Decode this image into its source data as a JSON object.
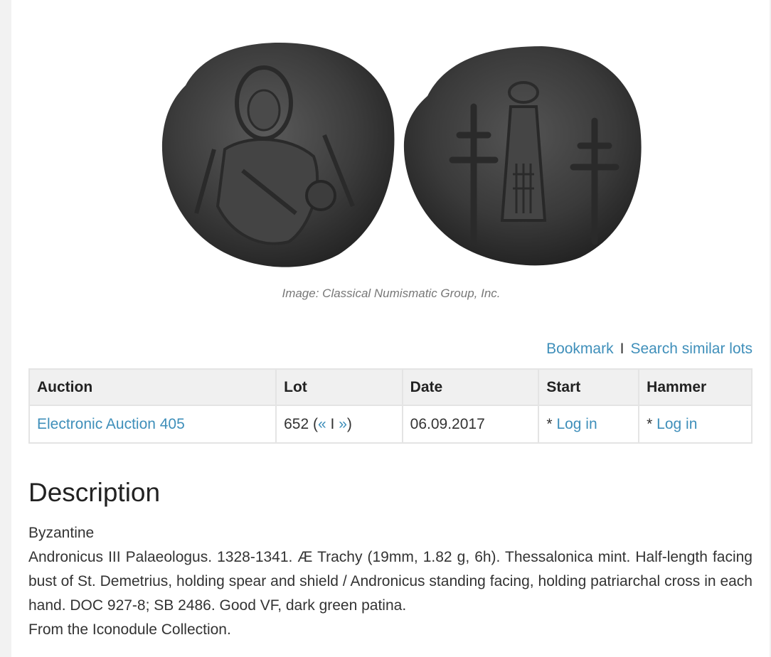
{
  "image": {
    "caption": "Image: Classical Numismatic Group, Inc.",
    "obverse_icon": "coin-obverse-st-demetrius",
    "reverse_icon": "coin-reverse-andronicus-crosses",
    "coin_color": "#3a3a3a"
  },
  "actions": {
    "bookmark": "Bookmark",
    "separator": "I",
    "search_similar": "Search similar lots"
  },
  "table": {
    "headers": {
      "auction": "Auction",
      "lot": "Lot",
      "date": "Date",
      "start": "Start",
      "hammer": "Hammer"
    },
    "row": {
      "auction": "Electronic Auction 405",
      "lot_number": "652 (",
      "lot_prev": "«",
      "lot_sep": " I ",
      "lot_next": "»",
      "lot_close": ")",
      "date": "06.09.2017",
      "start_prefix": "* ",
      "start_link": "Log in",
      "hammer_prefix": "* ",
      "hammer_link": "Log in"
    }
  },
  "description": {
    "title": "Description",
    "category": "Byzantine",
    "text": "Andronicus III Palaeologus. 1328-1341. Æ Trachy (19mm, 1.82 g, 6h). Thessalonica mint. Half-length facing bust of St. Demetrius, holding spear and shield / Andronicus standing facing, holding patriarchal cross in each hand. DOC 927-8; SB 2486. Good VF, dark green patina.",
    "provenance": "From the Iconodule Collection."
  },
  "colors": {
    "link": "#3f8fba",
    "header_bg": "#f0f0f0",
    "border": "#e4e4e4"
  }
}
